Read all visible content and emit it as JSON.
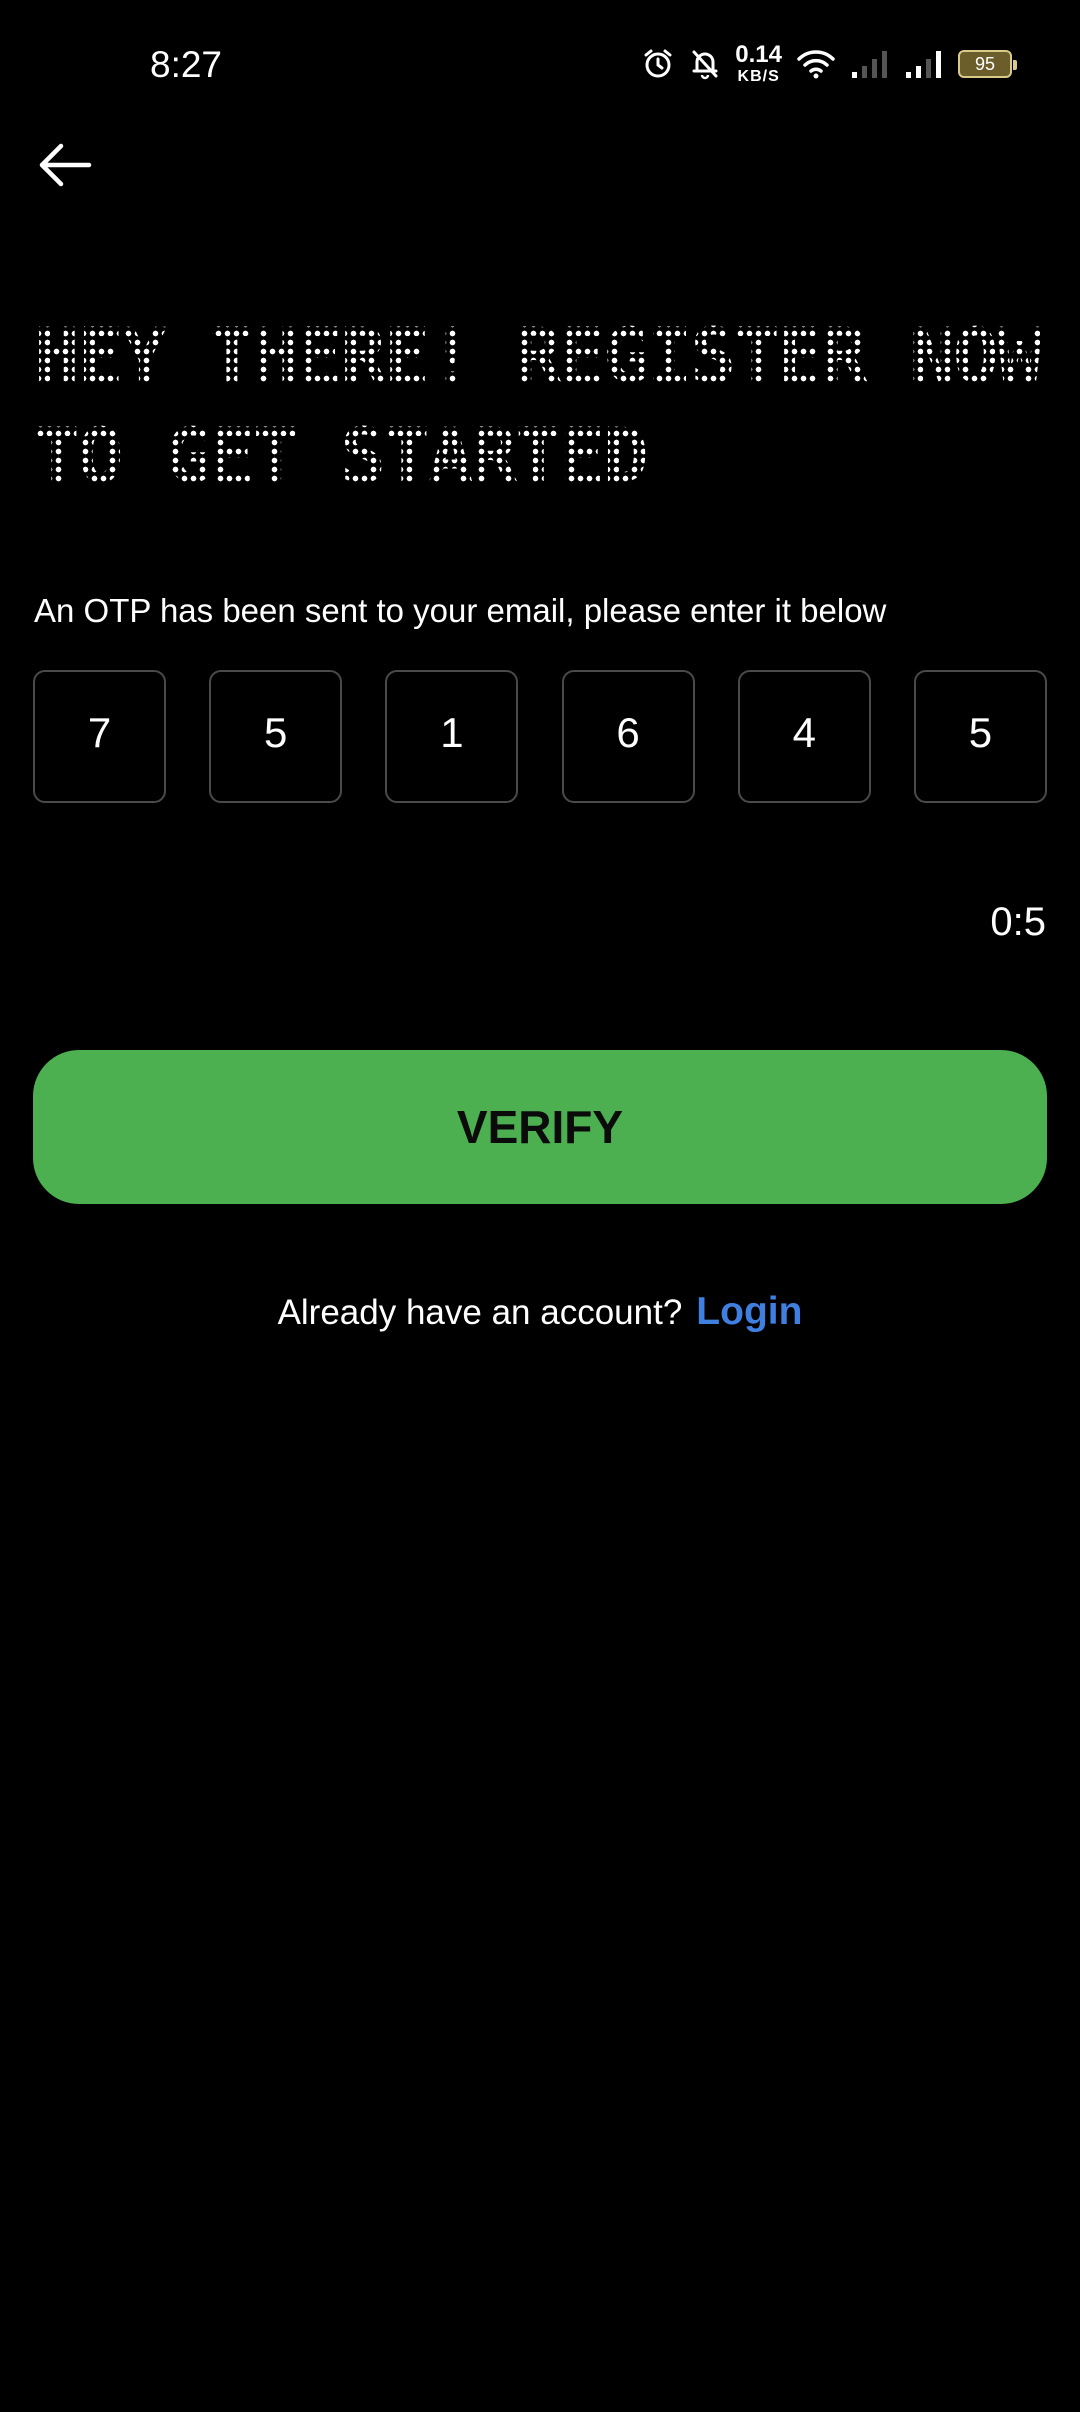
{
  "status_bar": {
    "time": "8:27",
    "net_speed_value": "0.14",
    "net_speed_unit": "KB/S",
    "battery_level": "95",
    "icons": [
      "alarm-icon",
      "bell-off-icon",
      "wifi-icon",
      "signal-icon",
      "signal-icon",
      "battery-icon"
    ]
  },
  "header": {
    "back_icon": "arrow-left-icon"
  },
  "main": {
    "title": "HEY THERE! REGISTER NOW TO GET STARTED",
    "subtitle": "An OTP has been sent to your email, please enter it below",
    "otp_digits": [
      "7",
      "5",
      "1",
      "6",
      "4",
      "5"
    ],
    "timer": "0:5",
    "verify_label": "VERIFY",
    "login_prompt": "Already have an account?",
    "login_link": "Login"
  },
  "colors": {
    "background": "#000000",
    "accent_green": "#4caf50",
    "link_blue": "#3f7fe0",
    "otp_border": "#4a4a4a"
  }
}
